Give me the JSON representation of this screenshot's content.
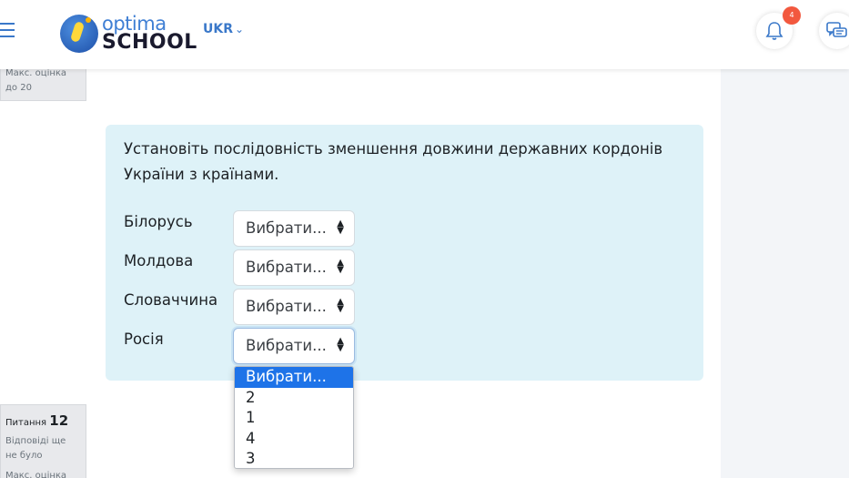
{
  "header": {
    "logo_top": "optima",
    "logo_bottom": "SCHOOL",
    "language": "UKR",
    "notification_count": "4"
  },
  "left_info_top": {
    "line1": "Макс. оцінка",
    "line2": "до 20"
  },
  "left_info_bottom": {
    "title_prefix": "Питання",
    "number": "12",
    "status_line1": "Відповіді ще",
    "status_line2": "не було",
    "max_grade": "Макс. оцінка"
  },
  "question": {
    "text": "Установіть послідовність зменшення довжини державних кордонів України з країнами.",
    "rows": [
      {
        "label": "Білорусь",
        "selected": "Вибрати..."
      },
      {
        "label": "Молдова",
        "selected": "Вибрати..."
      },
      {
        "label": "Словаччина",
        "selected": "Вибрати..."
      },
      {
        "label": "Росія",
        "selected": "Вибрати..."
      }
    ]
  },
  "dropdown": {
    "options": [
      "Вибрати...",
      "2",
      "1",
      "4",
      "3"
    ],
    "highlighted_index": 0
  },
  "colors": {
    "accent": "#3a78c9",
    "card_bg": "#def2f8",
    "badge": "#f2583e",
    "option_highlight": "#1e73e8"
  }
}
